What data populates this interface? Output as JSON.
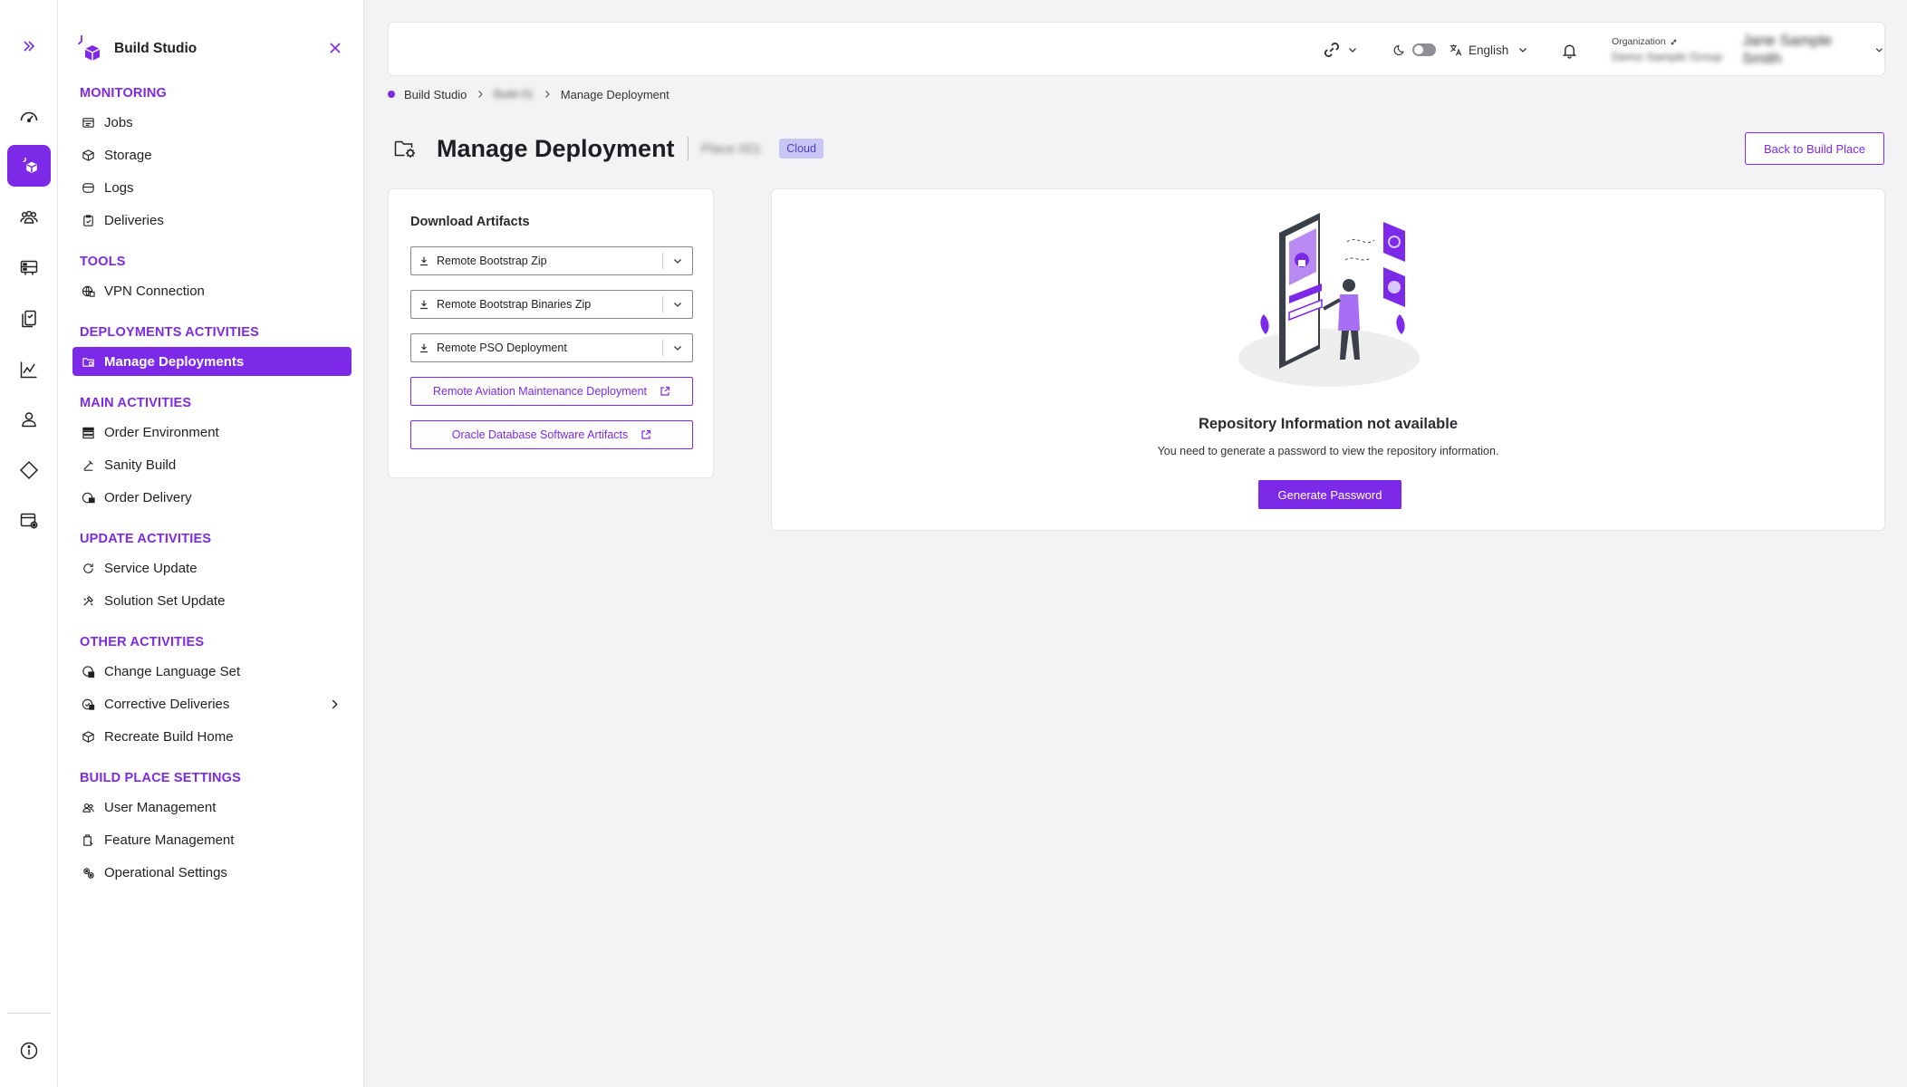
{
  "rail": {
    "items": [
      {
        "name": "expand-icon"
      },
      {
        "name": "dashboard-gauge-icon"
      },
      {
        "name": "build-studio-icon",
        "active": true
      },
      {
        "name": "team-icon"
      },
      {
        "name": "server-icon"
      },
      {
        "name": "tasks-icon"
      },
      {
        "name": "analytics-icon"
      },
      {
        "name": "user-icon"
      },
      {
        "name": "diamond-icon"
      },
      {
        "name": "settings-panel-icon"
      },
      {
        "name": "info-icon"
      }
    ]
  },
  "nav": {
    "app_title": "Build Studio",
    "sections": [
      {
        "title": "MONITORING",
        "items": [
          "Jobs",
          "Storage",
          "Logs",
          "Deliveries"
        ]
      },
      {
        "title": "TOOLS",
        "items": [
          "VPN Connection"
        ]
      },
      {
        "title": "DEPLOYMENTS ACTIVITIES",
        "items": [
          "Manage Deployments"
        ]
      },
      {
        "title": "MAIN ACTIVITIES",
        "items": [
          "Order Environment",
          "Sanity Build",
          "Order Delivery"
        ]
      },
      {
        "title": "UPDATE ACTIVITIES",
        "items": [
          "Service Update",
          "Solution Set Update"
        ]
      },
      {
        "title": "OTHER ACTIVITIES",
        "items": [
          "Change Language Set",
          "Corrective Deliveries",
          "Recreate Build Home"
        ]
      },
      {
        "title": "BUILD PLACE SETTINGS",
        "items": [
          "User Management",
          "Feature Management",
          "Operational Settings"
        ]
      }
    ],
    "active_item": "Manage Deployments"
  },
  "topbar": {
    "language": "English",
    "org_label": "Organization",
    "org_value": "Demo Sample Group",
    "user_name": "Jane Sample Smith"
  },
  "breadcrumb": {
    "root": "Build Studio",
    "middle": "Build 01",
    "current": "Manage Deployment"
  },
  "page": {
    "title": "Manage Deployment",
    "subtitle": "Place 001",
    "badge": "Cloud",
    "back_button": "Back to Build Place"
  },
  "download": {
    "title": "Download Artifacts",
    "dropdowns": [
      "Remote Bootstrap Zip",
      "Remote Bootstrap Binaries Zip",
      "Remote PSO Deployment"
    ],
    "links": [
      "Remote Aviation Maintenance Deployment",
      "Oracle Database Software Artifacts"
    ]
  },
  "repository": {
    "title": "Repository Information not available",
    "message": "You need to generate a password to view the repository information.",
    "button": "Generate Password"
  },
  "colors": {
    "accent": "#7d2ae8",
    "badge_bg": "#c7c6f5",
    "badge_text": "#4b3fc0",
    "page_bg": "#f3f2f5"
  }
}
